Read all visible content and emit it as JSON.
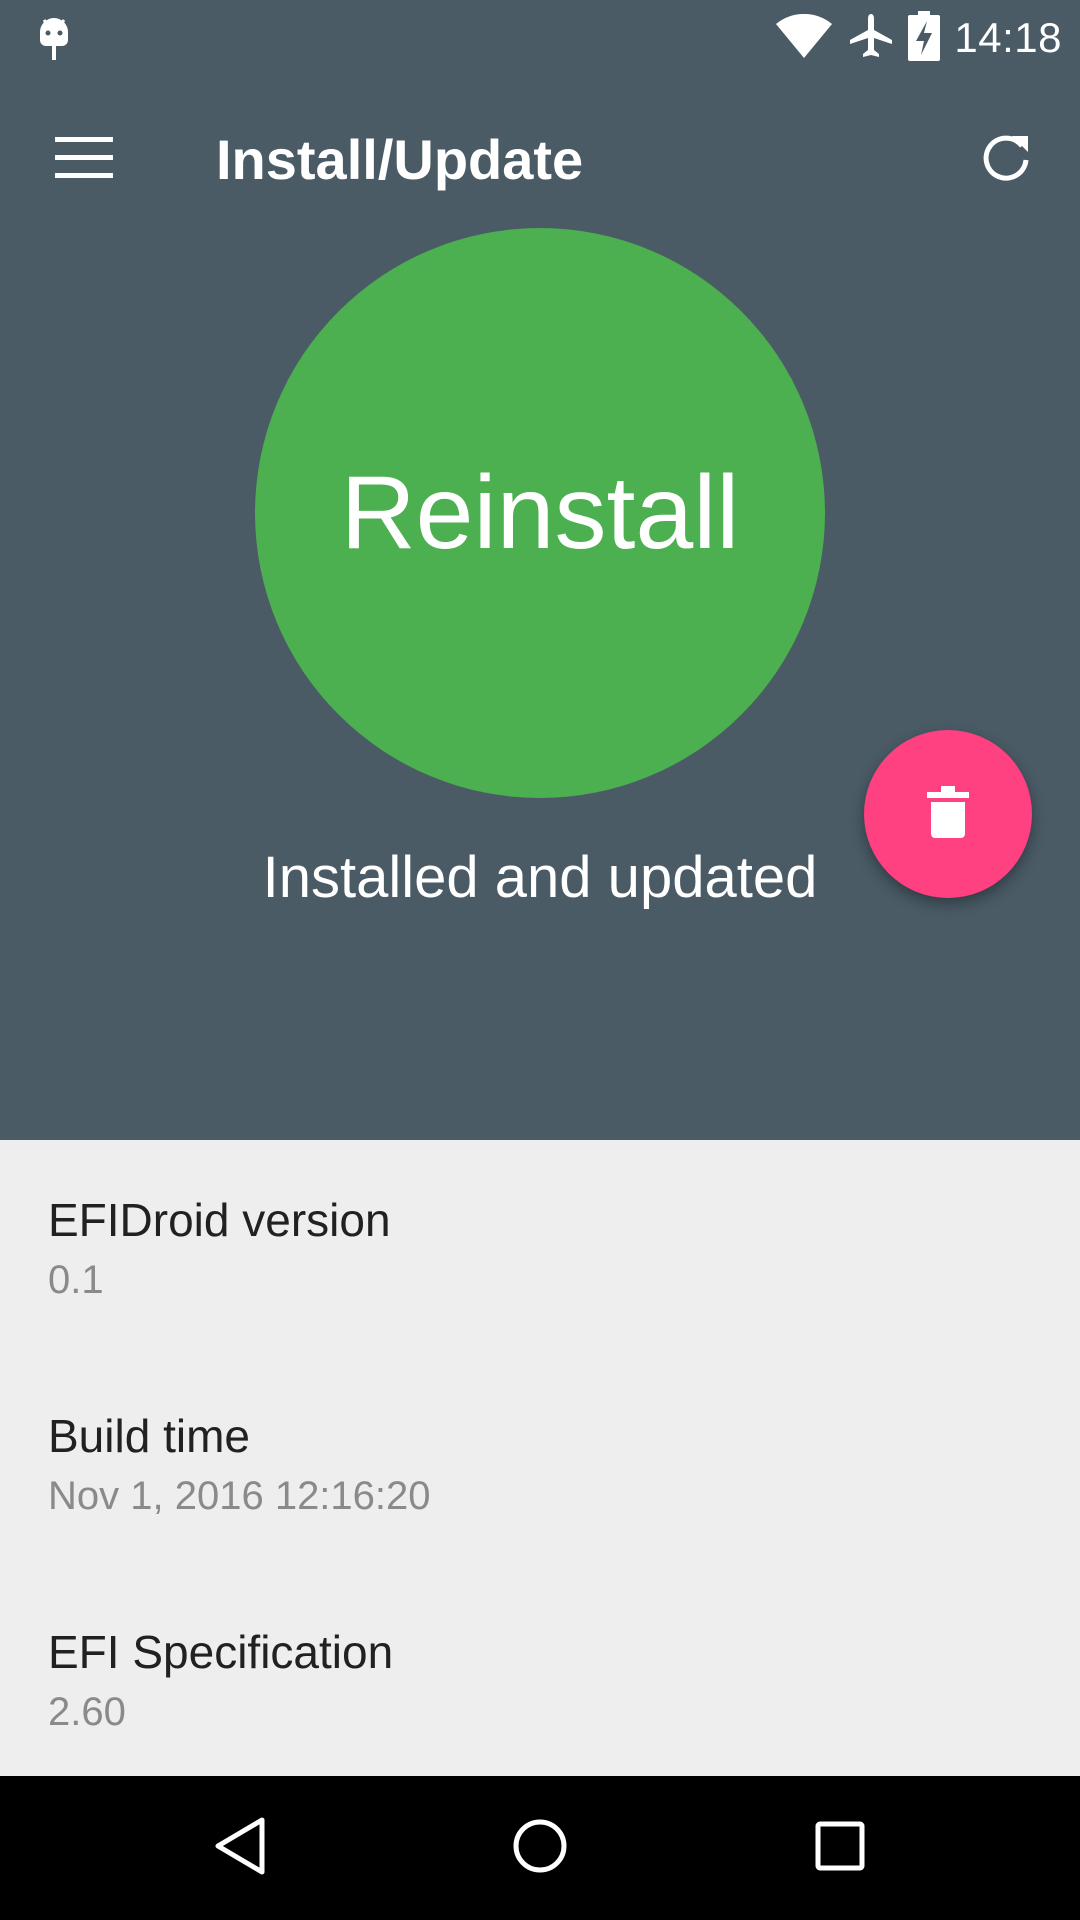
{
  "status_bar": {
    "time": "14:18",
    "icons": [
      "android-debug-icon",
      "wifi-icon",
      "airplane-mode-icon",
      "battery-charging-icon"
    ]
  },
  "app_bar": {
    "title": "Install/Update",
    "menu_icon": "menu-icon",
    "refresh_icon": "refresh-icon"
  },
  "main": {
    "primary_action_label": "Reinstall",
    "status_text": "Installed and updated",
    "fab_icon": "delete-icon"
  },
  "info": [
    {
      "title": "EFIDroid version",
      "value": "0.1"
    },
    {
      "title": "Build time",
      "value": "Nov 1, 2016 12:16:20"
    },
    {
      "title": "EFI Specification",
      "value": "2.60"
    }
  ],
  "nav_bar": {
    "icons": [
      "back-icon",
      "home-icon",
      "recents-icon"
    ]
  },
  "colors": {
    "header_background": "#4a5b66",
    "primary_button": "#4caf50",
    "fab": "#ff4081",
    "list_background": "#eeeeee"
  }
}
